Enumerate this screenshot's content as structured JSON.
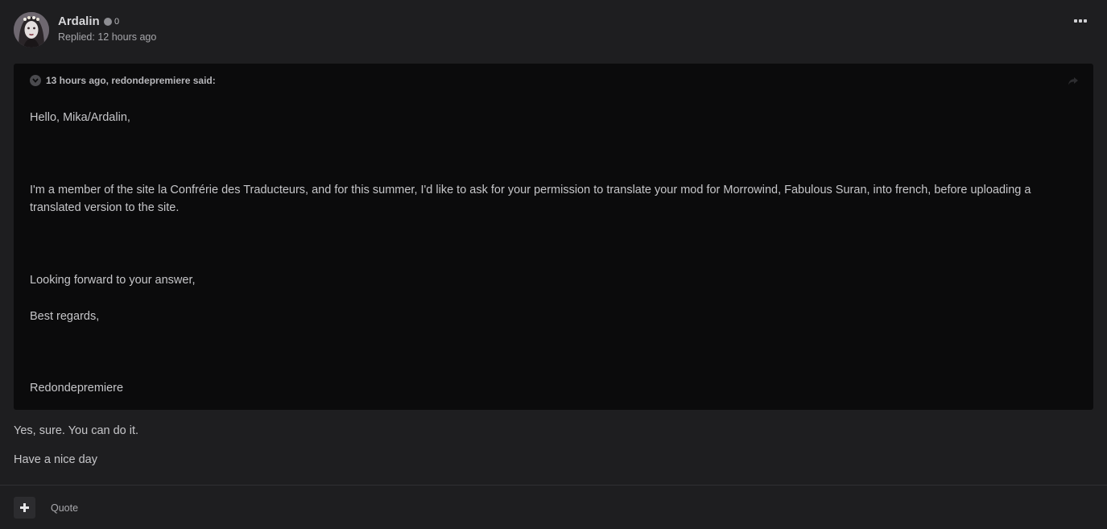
{
  "post": {
    "author": "Ardalin",
    "reputation": "0",
    "replied": "Replied: 12 hours ago"
  },
  "quote": {
    "citation": "13 hours ago, redondepremiere said:",
    "lines": [
      "Hello, Mika/Ardalin,",
      "I'm a member of the site la Confrérie des Traducteurs, and for this summer, I'd like to ask for your permission to translate your mod for Morrowind, Fabulous Suran, into french, before uploading a translated version to the site.",
      "Looking forward to your answer,",
      "Best regards,",
      "Redondepremiere"
    ]
  },
  "reply": {
    "lines": [
      "Yes, sure. You can do it.",
      "Have a nice day"
    ]
  },
  "footer": {
    "quote_label": "Quote"
  },
  "icons": {
    "menu": "ellipsis-icon",
    "toggle": "chevron-down-icon",
    "share": "share-icon",
    "add": "plus-icon"
  },
  "colors": {
    "background": "#1e1e20",
    "quote_background": "#0b0b0c",
    "text": "#c6c6c9"
  }
}
